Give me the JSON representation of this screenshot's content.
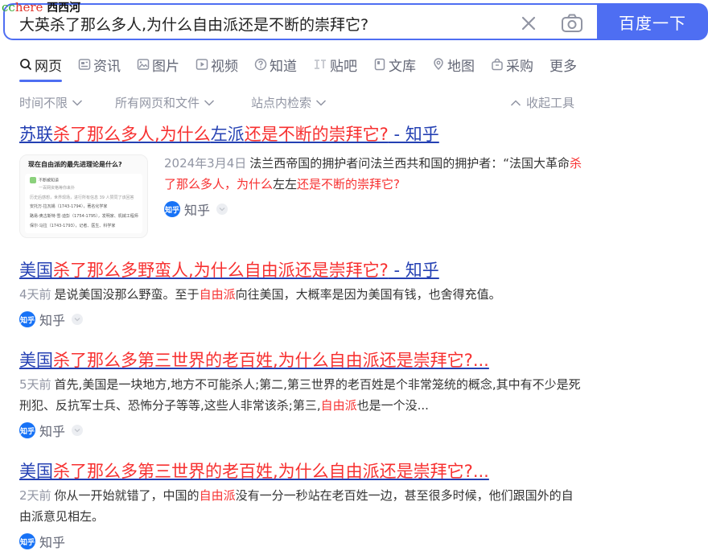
{
  "watermark": {
    "cc": "cc",
    "here": "here",
    "name": "西西河"
  },
  "search": {
    "query": "大英杀了那么多人,为什么自由派还是不断的崇拜它?",
    "button_label": "百度一下"
  },
  "tabs": [
    {
      "label": "网页",
      "icon": "search-icon",
      "active": true
    },
    {
      "label": "资讯",
      "icon": "news-icon"
    },
    {
      "label": "图片",
      "icon": "image-icon"
    },
    {
      "label": "视频",
      "icon": "video-icon"
    },
    {
      "label": "知道",
      "icon": "question-icon"
    },
    {
      "label": "贴吧",
      "icon": "tieba-icon"
    },
    {
      "label": "文库",
      "icon": "doc-icon"
    },
    {
      "label": "地图",
      "icon": "map-pin-icon"
    },
    {
      "label": "采购",
      "icon": "shopping-bag-icon"
    },
    {
      "label": "更多"
    }
  ],
  "filters": {
    "time": "时间不限",
    "type": "所有网页和文件",
    "site": "站点内检索",
    "collapse": "收起工具"
  },
  "results": [
    {
      "title_parts": [
        "苏联",
        "杀了那么多人",
        ",为什么",
        "左派",
        "还是不断的崇拜它?",
        " - 知乎"
      ],
      "date": "2024年3月4日",
      "snippet_a": "法兰西帝国的拥护者问法兰西共和国的拥护者：“法国大革命",
      "snippet_hl": "杀了那么多人，为什么",
      "snippet_b": "左左",
      "snippet_hl2": "还是不断的崇拜它?",
      "source": "知乎",
      "thumb": {
        "title": "现在自由派的最先进理论是什么?",
        "line1": "不断被知道",
        "line2": "一百网资格等你来扑",
        "line3": "历史后感想，世界现场，进行所有信息 39 人赞同了该回答",
        "line4": "安托万·拉瓦锡（1743-1794），著名化学家",
        "line5": "路易-奥古斯特·雪·迪彭（1754-1795），发明家、机械工程师",
        "line6": "保尔·马拉（1743-1793），记者、医生、科学家"
      }
    },
    {
      "title_parts": [
        "美国",
        "杀了那么多野蛮人",
        ",为什么自由派还是崇拜它?",
        " - 知乎"
      ],
      "date": "4天前",
      "snippet_a": "是说美国没那么野蛮。至于",
      "snippet_hl": "自由派",
      "snippet_b": "向往美国，大概率是因为美国有钱，也舍得充值。",
      "source": "知乎"
    },
    {
      "title_parts": [
        "美国",
        "杀了那么多第三世界的老百姓",
        ",为什么自由派还是崇拜它?..."
      ],
      "date": "5天前",
      "snippet_a": "首先,美国是一块地方,地方不可能杀人;第二,第三世界的老百姓是个非常笼统的概念,其中有不少是死刑犯、反抗军士兵、恐怖分子等等,这些人非常该杀;第三,",
      "snippet_hl": "自由派",
      "snippet_b": "也是一个没...",
      "source": "知乎"
    },
    {
      "title_parts": [
        "美国",
        "杀了那么多第三世界的老百姓",
        ",为什么自由派还是崇拜它?..."
      ],
      "date": "2天前",
      "snippet_a": "你从一开始就错了，中国的",
      "snippet_hl": "自由派",
      "snippet_b": "没有一分一秒站在老百姓一边，甚至很多时候，他们跟国外的自由派意见相左。",
      "source": "知乎"
    }
  ]
}
